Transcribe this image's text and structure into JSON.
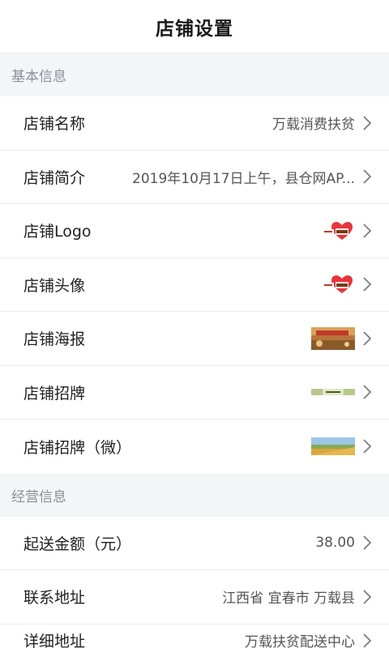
{
  "header": {
    "title": "店铺设置"
  },
  "sections": {
    "basic": {
      "title": "基本信息",
      "rows": [
        {
          "label": "店铺名称",
          "value": "万载消费扶贫"
        },
        {
          "label": "店铺简介",
          "value": "2019年10月17日上午，县仓网AP..."
        },
        {
          "label": "店铺Logo",
          "value": "万载扶贫"
        },
        {
          "label": "店铺头像",
          "value": "万载扶贫"
        },
        {
          "label": "店铺海报"
        },
        {
          "label": "店铺招牌"
        },
        {
          "label": "店铺招牌（微）"
        }
      ]
    },
    "business": {
      "title": "经营信息",
      "rows": [
        {
          "label": "起送金额（元）",
          "value": "38.00"
        },
        {
          "label": "联系地址",
          "value": "江西省 宜春市 万载县"
        },
        {
          "label": "详细地址",
          "value": "万载扶贫配送中心"
        }
      ]
    }
  },
  "colors": {
    "heart": "#e8343c",
    "accent_text": "#7a3a10",
    "chevron": "#7d7d7d"
  },
  "icons": {
    "chevron": "chevron-right-icon",
    "heart": "heart-logo-icon"
  }
}
